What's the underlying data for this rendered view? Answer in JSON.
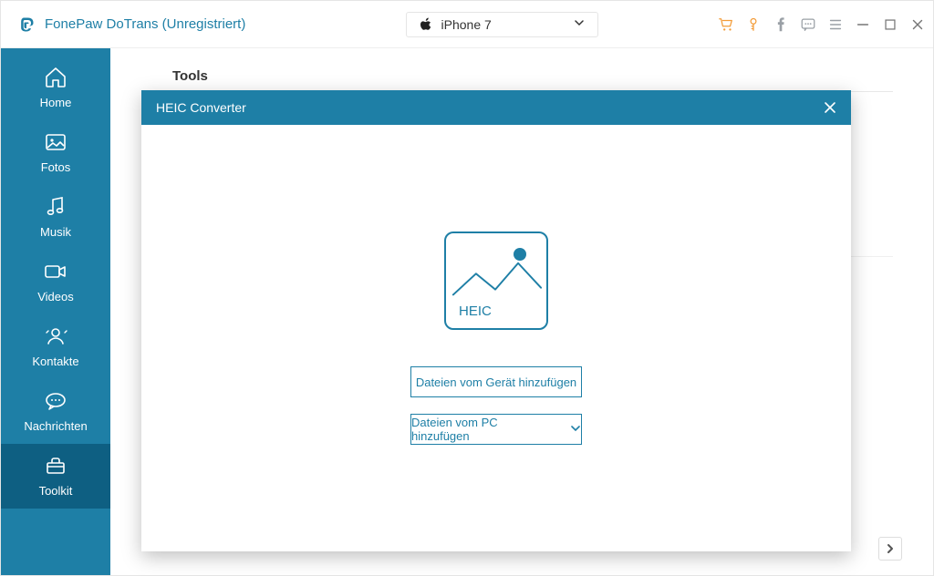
{
  "titlebar": {
    "app_name": "FonePaw DoTrans (Unregistriert)",
    "device_name": "iPhone 7"
  },
  "sidebar": {
    "items": [
      {
        "id": "home",
        "label": "Home"
      },
      {
        "id": "fotos",
        "label": "Fotos"
      },
      {
        "id": "musik",
        "label": "Musik"
      },
      {
        "id": "videos",
        "label": "Videos"
      },
      {
        "id": "kontakte",
        "label": "Kontakte"
      },
      {
        "id": "nachrichten",
        "label": "Nachrichten"
      },
      {
        "id": "toolkit",
        "label": "Toolkit"
      }
    ],
    "active_index": 6
  },
  "main": {
    "section_title": "Tools"
  },
  "modal": {
    "title": "HEIC Converter",
    "heic_badge": "HEIC",
    "add_from_device_label": "Dateien vom Gerät hinzufügen",
    "add_from_pc_label": "Dateien vom PC hinzufügen"
  }
}
